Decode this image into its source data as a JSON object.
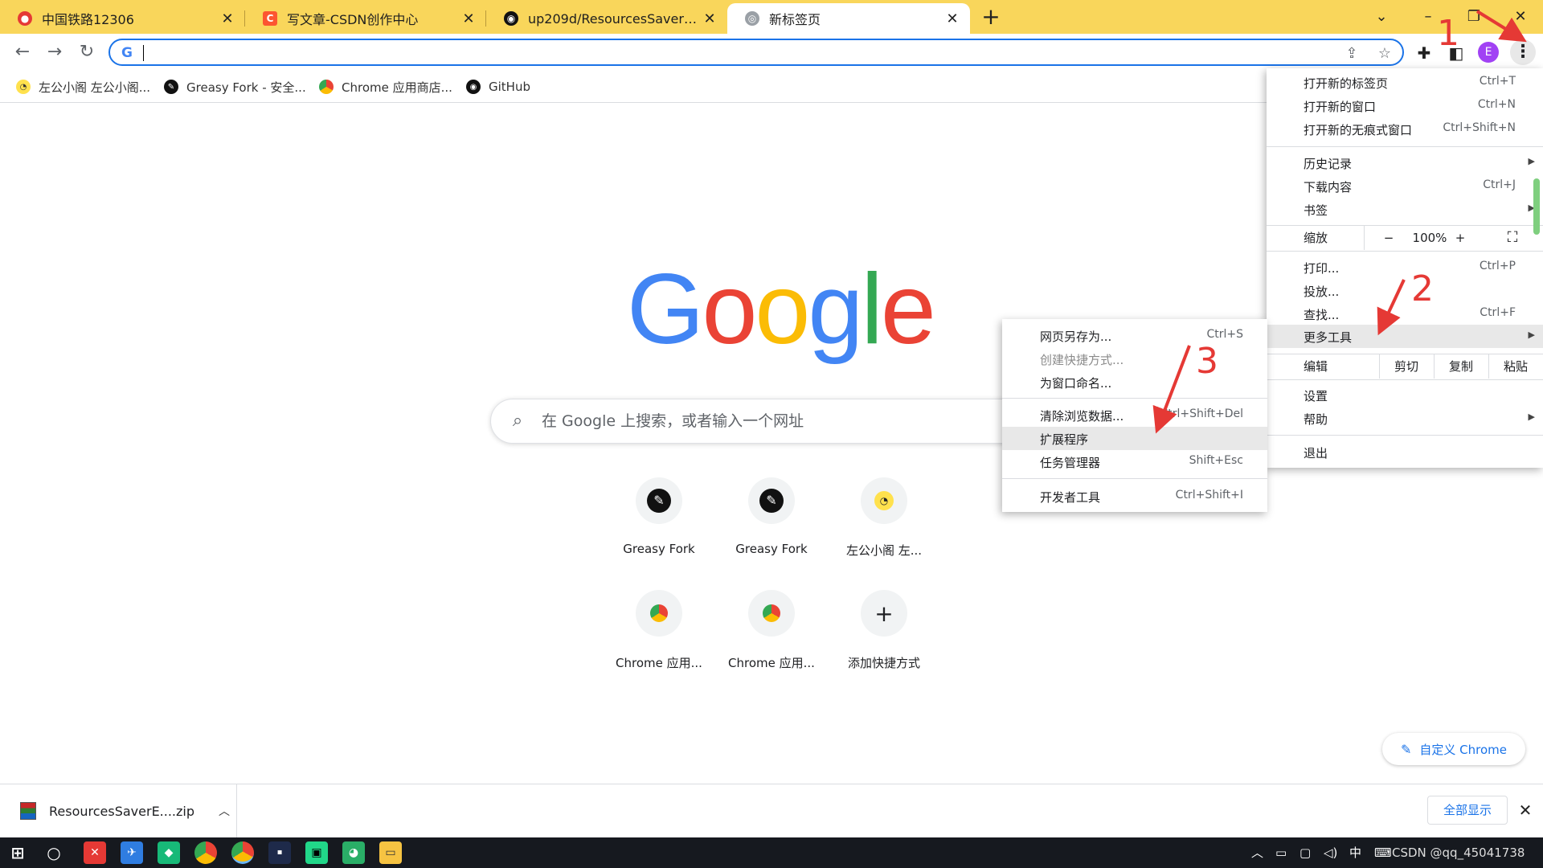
{
  "tabs": [
    {
      "title": "中国铁路12306",
      "favicon": "12306-icon",
      "color": "#e53935"
    },
    {
      "title": "写文章-CSDN创作中心",
      "favicon": "csdn-icon",
      "color": "#fc5531"
    },
    {
      "title": "up209d/ResourcesSaverExt: Cl",
      "favicon": "github-icon",
      "color": "#111111"
    },
    {
      "title": "新标签页",
      "favicon": "chrome-icon",
      "color": "#777777",
      "active": true
    }
  ],
  "omnibox": {
    "value": ""
  },
  "profile": {
    "initial": "E"
  },
  "bookmarks": [
    {
      "label": "左公小阁 左公小阁...",
      "icon": "zuogong-icon"
    },
    {
      "label": "Greasy Fork - 安全...",
      "icon": "greasyfork-icon"
    },
    {
      "label": "Chrome 应用商店...",
      "icon": "chrome-webstore-icon"
    },
    {
      "label": "GitHub",
      "icon": "github-icon"
    }
  ],
  "google": {
    "logo_letters": [
      "G",
      "o",
      "o",
      "g",
      "l",
      "e"
    ],
    "search_placeholder": "在 Google 上搜索，或者输入一个网址"
  },
  "shortcuts": [
    {
      "label": "Greasy Fork",
      "icon": "greasyfork-icon"
    },
    {
      "label": "Greasy Fork",
      "icon": "greasyfork-icon"
    },
    {
      "label": "左公小阁 左...",
      "icon": "zuogong-icon"
    },
    {
      "label": "Chrome 应用...",
      "icon": "chrome-webstore-icon"
    },
    {
      "label": "Chrome 应用...",
      "icon": "chrome-webstore-icon"
    },
    {
      "label": "添加快捷方式",
      "icon": "plus-icon"
    }
  ],
  "customize_label": "自定义 Chrome",
  "downloads": {
    "file": "ResourcesSaverE....zip",
    "show_all": "全部显示"
  },
  "menu": {
    "new_tab": {
      "label": "打开新的标签页",
      "shortcut": "Ctrl+T"
    },
    "new_window": {
      "label": "打开新的窗口",
      "shortcut": "Ctrl+N"
    },
    "incognito": {
      "label": "打开新的无痕式窗口",
      "shortcut": "Ctrl+Shift+N"
    },
    "history": {
      "label": "历史记录"
    },
    "downloads": {
      "label": "下载内容",
      "shortcut": "Ctrl+J"
    },
    "bookmarks": {
      "label": "书签"
    },
    "zoom": {
      "label": "缩放",
      "minus": "−",
      "value": "100%",
      "plus": "+"
    },
    "print": {
      "label": "打印...",
      "shortcut": "Ctrl+P"
    },
    "cast": {
      "label": "投放..."
    },
    "find": {
      "label": "查找...",
      "shortcut": "Ctrl+F"
    },
    "more_tools": {
      "label": "更多工具"
    },
    "edit": {
      "label": "编辑",
      "cut": "剪切",
      "copy": "复制",
      "paste": "粘贴"
    },
    "settings": {
      "label": "设置"
    },
    "help": {
      "label": "帮助"
    },
    "exit": {
      "label": "退出"
    }
  },
  "submenu": {
    "save_page": {
      "label": "网页另存为...",
      "shortcut": "Ctrl+S"
    },
    "create_shortcut": {
      "label": "创建快捷方式..."
    },
    "name_window": {
      "label": "为窗口命名..."
    },
    "clear_data": {
      "label": "清除浏览数据...",
      "shortcut": "Ctrl+Shift+Del"
    },
    "extensions": {
      "label": "扩展程序"
    },
    "task_manager": {
      "label": "任务管理器",
      "shortcut": "Shift+Esc"
    },
    "dev_tools": {
      "label": "开发者工具",
      "shortcut": "Ctrl+Shift+I"
    }
  },
  "annotations": [
    "1",
    "2",
    "3"
  ],
  "taskbar": {
    "ime": "中",
    "tray_text": "CSDN @qq_45041738"
  },
  "colors": {
    "tabstrip": "#f9d65b",
    "accent": "#1a73e8",
    "annotation": "#e53935"
  }
}
